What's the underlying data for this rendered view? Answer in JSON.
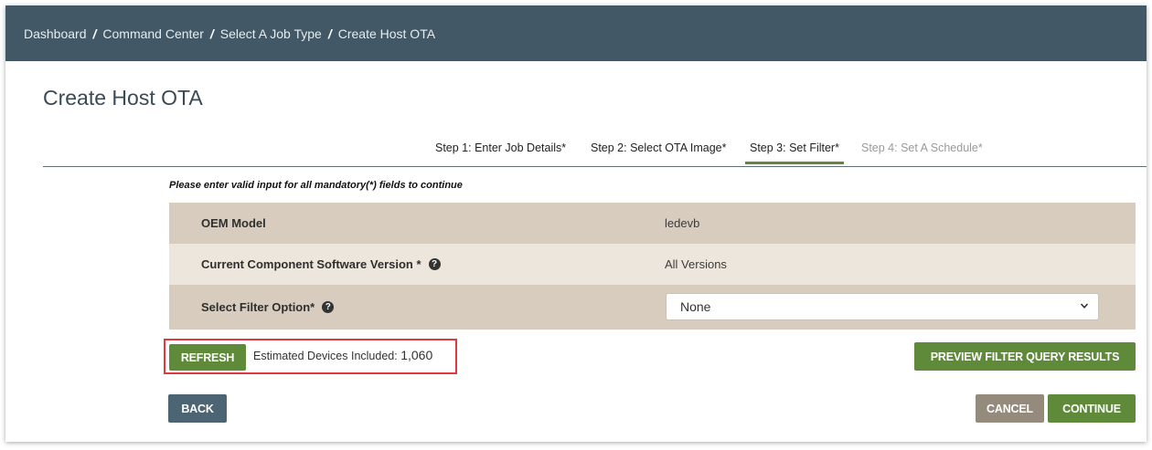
{
  "breadcrumb": {
    "items": [
      "Dashboard",
      "Command Center",
      "Select A Job Type",
      "Create Host OTA"
    ],
    "separator": "/"
  },
  "page": {
    "title": "Create Host OTA"
  },
  "steps": [
    {
      "label": "Step 1: Enter Job Details*",
      "state": "done"
    },
    {
      "label": "Step 2: Select OTA Image*",
      "state": "done"
    },
    {
      "label": "Step 3: Set Filter*",
      "state": "active"
    },
    {
      "label": "Step 4: Set A Schedule*",
      "state": "disabled"
    }
  ],
  "notice": "Please enter valid input for all mandatory(*) fields to continue",
  "form": {
    "oem_model": {
      "label": "OEM Model",
      "value": "ledevb"
    },
    "software_version": {
      "label": "Current Component Software Version *",
      "value": "All Versions",
      "help_icon": "question-circle-icon"
    },
    "filter_option": {
      "label": "Select Filter Option*",
      "selected": "None",
      "help_icon": "question-circle-icon"
    }
  },
  "actions": {
    "refresh_label": "REFRESH",
    "estimated_label": "Estimated Devices Included:",
    "estimated_count": "1,060",
    "preview_label": "PREVIEW FILTER QUERY RESULTS",
    "back_label": "BACK",
    "cancel_label": "CANCEL",
    "continue_label": "CONTINUE"
  },
  "colors": {
    "header_bg": "#425866",
    "primary_green": "#5e8a3a",
    "slate_button": "#4d6472",
    "taupe_button": "#948b7c",
    "row_dark": "#d7ccbd",
    "row_light": "#ede6dc",
    "highlight_border": "#e0383f"
  }
}
